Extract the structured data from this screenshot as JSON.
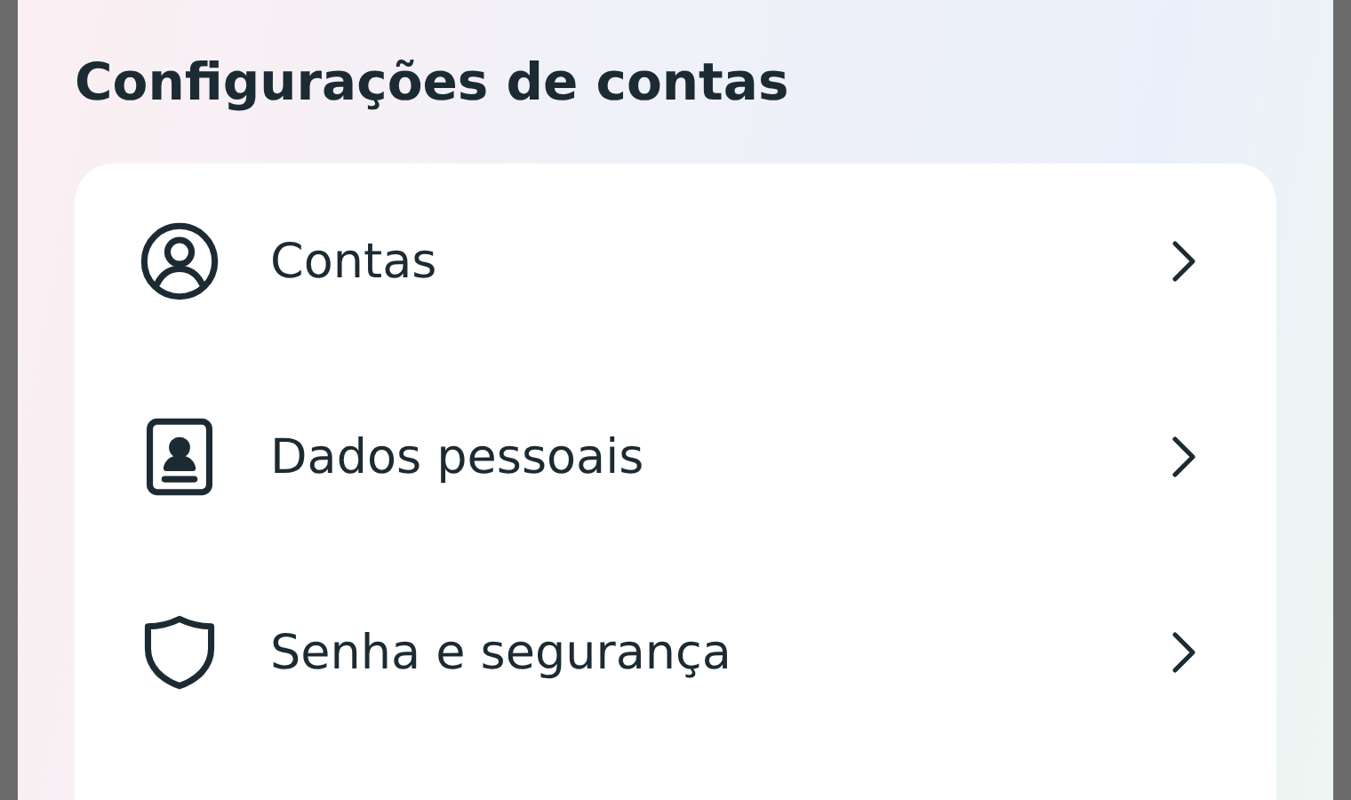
{
  "title": "Configurações de contas",
  "items": [
    {
      "kind": "person",
      "label": "Contas"
    },
    {
      "kind": "id-card",
      "label": "Dados pessoais"
    },
    {
      "kind": "shield",
      "label": "Senha e segurança"
    }
  ]
}
